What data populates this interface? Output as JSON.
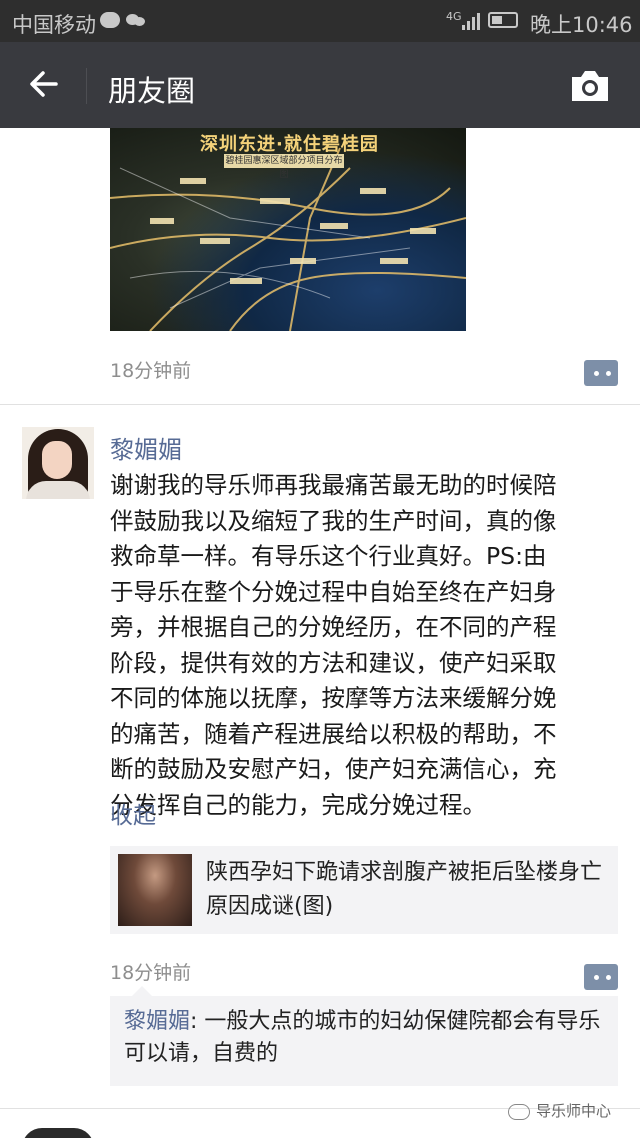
{
  "status_bar": {
    "carrier": "中国移动",
    "network": "4G",
    "time": "晚上10:46"
  },
  "nav": {
    "title": "朋友圈"
  },
  "previous_post": {
    "map_banner": "深圳东进·就住碧桂园",
    "map_subtitle": "碧桂园惠深区域部分项目分布图",
    "time": "18分钟前"
  },
  "post": {
    "author": "黎媚媚",
    "text": "谢谢我的导乐师再我最痛苦最无助的时候陪\n伴鼓励我以及缩短了我的生产时间，真的像\n救命草一样。有导乐这个行业真好。PS:由\n于导乐在整个分娩过程中自始至终在产妇身\n旁，并根据自己的分娩经历，在不同的产程\n阶段，提供有效的方法和建议，使产妇采取\n不同的体施以抚摩，按摩等方法来缓解分娩\n的痛苦，随着产程进展给以积极的帮助，不\n断的鼓励及安慰产妇，使产妇充满信心，充\n分发挥自己的能力，完成分娩过程。",
    "collapse_label": "收起",
    "shared_link_title": "陕西孕妇下跪请求剖腹产被拒后坠楼身亡 原因成谜(图)",
    "time": "18分钟前",
    "comments": [
      {
        "name": "黎媚媚",
        "separator": ": ",
        "text": "一般大点的城市的妇幼保健院都会有导乐可以请，自费的"
      }
    ]
  },
  "watermark": "导乐师中心"
}
